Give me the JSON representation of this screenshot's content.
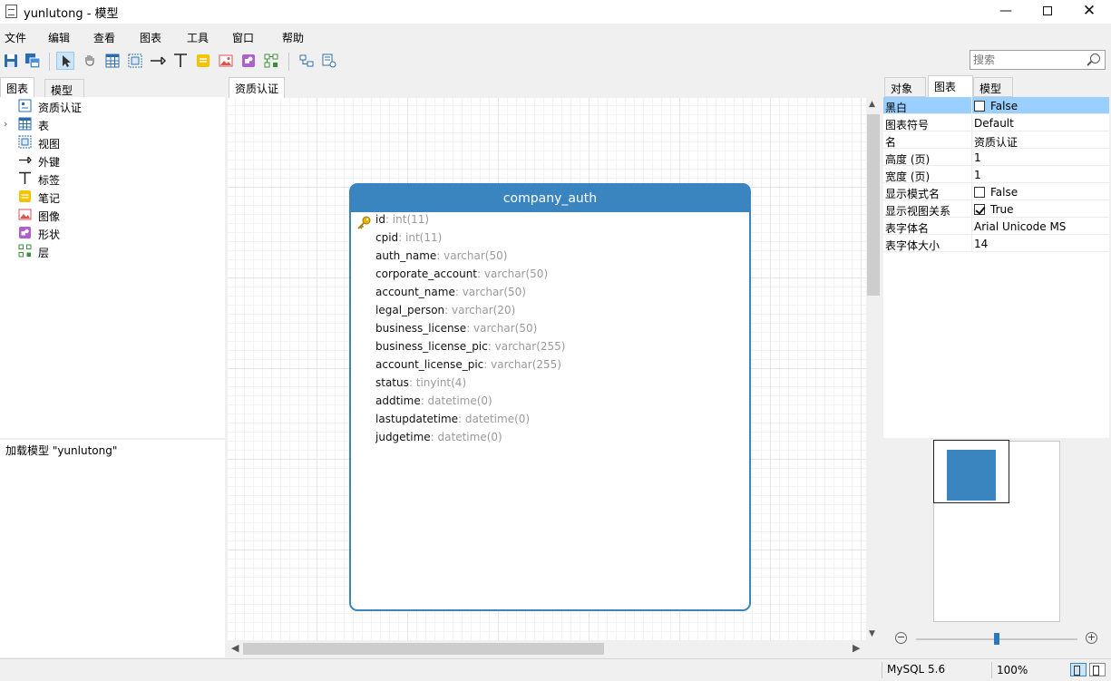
{
  "window": {
    "title": "yunlutong - 模型",
    "minimize": "—",
    "close": "✕"
  },
  "menu": [
    "文件",
    "编辑",
    "查看",
    "图表",
    "工具",
    "窗口",
    "帮助"
  ],
  "search": {
    "placeholder": "搜索"
  },
  "left_panel": {
    "tabs": [
      "图表",
      "模型"
    ],
    "tree": [
      {
        "label": "资质认证",
        "icon": "diagram-icon"
      },
      {
        "label": "表",
        "icon": "table-icon",
        "expandable": true
      },
      {
        "label": "视图",
        "icon": "view-icon"
      },
      {
        "label": "外键",
        "icon": "foreign-key-icon"
      },
      {
        "label": "标签",
        "icon": "label-icon"
      },
      {
        "label": "笔记",
        "icon": "note-icon"
      },
      {
        "label": "图像",
        "icon": "image-icon"
      },
      {
        "label": "形状",
        "icon": "shape-icon"
      },
      {
        "label": "层",
        "icon": "layer-icon"
      }
    ],
    "log": "加载模型 \"yunlutong\""
  },
  "canvas": {
    "tab": "资质认证",
    "entity": {
      "name": "company_auth",
      "fields": [
        {
          "name": "id",
          "type": ": int(11)",
          "key": true
        },
        {
          "name": "cpid",
          "type": ": int(11)"
        },
        {
          "name": "auth_name",
          "type": ": varchar(50)"
        },
        {
          "name": "corporate_account",
          "type": ": varchar(50)"
        },
        {
          "name": "account_name",
          "type": ": varchar(50)"
        },
        {
          "name": "legal_person",
          "type": ": varchar(20)"
        },
        {
          "name": "business_license",
          "type": ": varchar(50)"
        },
        {
          "name": "business_license_pic",
          "type": ": varchar(255)"
        },
        {
          "name": "account_license_pic",
          "type": ": varchar(255)"
        },
        {
          "name": "status",
          "type": ": tinyint(4)"
        },
        {
          "name": "addtime",
          "type": ": datetime(0)"
        },
        {
          "name": "lastupdatetime",
          "type": ": datetime(0)"
        },
        {
          "name": "judgetime",
          "type": ": datetime(0)"
        }
      ]
    }
  },
  "right_panel": {
    "tabs": [
      "对象",
      "图表",
      "模型"
    ],
    "properties": [
      {
        "name": "黑白",
        "value": "False",
        "checkbox": "off",
        "selected": true
      },
      {
        "name": "图表符号",
        "value": "Default"
      },
      {
        "name": "名",
        "value": "资质认证"
      },
      {
        "name": "高度 (页)",
        "value": "1"
      },
      {
        "name": "宽度 (页)",
        "value": "1"
      },
      {
        "name": "显示模式名",
        "value": "False",
        "checkbox": "off"
      },
      {
        "name": "显示视图关系",
        "value": "True",
        "checkbox": "on"
      },
      {
        "name": "表字体名",
        "value": "Arial Unicode MS"
      },
      {
        "name": "表字体大小",
        "value": "14"
      }
    ]
  },
  "zoom": {
    "minus": "−",
    "plus": "+",
    "level": 0.5
  },
  "status": {
    "db": "MySQL 5.6",
    "zoom": "100%"
  },
  "colors": {
    "accent": "#3a84c0",
    "selected_row": "#99d0ff"
  }
}
